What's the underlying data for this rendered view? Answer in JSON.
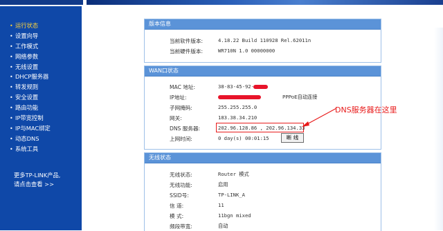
{
  "sidebar": {
    "items": [
      {
        "label": "运行状态",
        "active": true
      },
      {
        "label": "设置向导"
      },
      {
        "label": "工作模式"
      },
      {
        "label": "网络参数"
      },
      {
        "label": "无线设置"
      },
      {
        "label": "DHCP服务器"
      },
      {
        "label": "转发规则"
      },
      {
        "label": "安全设置"
      },
      {
        "label": "路由功能"
      },
      {
        "label": "IP带宽控制"
      },
      {
        "label": "IP与MAC绑定"
      },
      {
        "label": "动态DNS"
      },
      {
        "label": "系统工具"
      }
    ],
    "promo_line1": "更多TP-LINK产品,",
    "promo_line2": "请点击查看 >>"
  },
  "version_panel": {
    "title": "版本信息",
    "software_label": "当前软件版本:",
    "software_value": "4.18.22 Build 110928 Rel.62011n",
    "hardware_label": "当前硬件版本:",
    "hardware_value": "WR710N 1.0 00000000"
  },
  "wan_panel": {
    "title": "WAN口状态",
    "mac_label": "MAC 地址:",
    "mac_value": "38-83-45-92-",
    "ip_label": "IP地址:",
    "ip_mode": "PPPoE自动连接",
    "mask_label": "子网掩码:",
    "mask_value": "255.255.255.0",
    "gateway_label": "网关:",
    "gateway_value": "183.38.34.210",
    "dns_label": "DNS 服务器:",
    "dns_value": "202.96.128.86 , 202.96.134.33",
    "uptime_label": "上网时间:",
    "uptime_value": "0 day(s) 00:01:15",
    "disconnect_label": "断 线"
  },
  "wireless_panel": {
    "title": "无线状态",
    "rows": [
      {
        "label": "无线状态:",
        "value": "Router 模式"
      },
      {
        "label": "无线功能:",
        "value": "启用"
      },
      {
        "label": "SSID号:",
        "value": "TP-LINK_A"
      },
      {
        "label": "信 道:",
        "value": "11"
      },
      {
        "label": "模 式:",
        "value": "11bgn mixed"
      },
      {
        "label": "频段带宽:",
        "value": "自动"
      }
    ]
  },
  "annotation": {
    "text": "DNS服务器在这里",
    "color": "#e81a1a"
  },
  "colors": {
    "sidebar_bg": "#0f48a8",
    "panel_header": "#5b93d8",
    "active_menu": "#ffd43a"
  }
}
